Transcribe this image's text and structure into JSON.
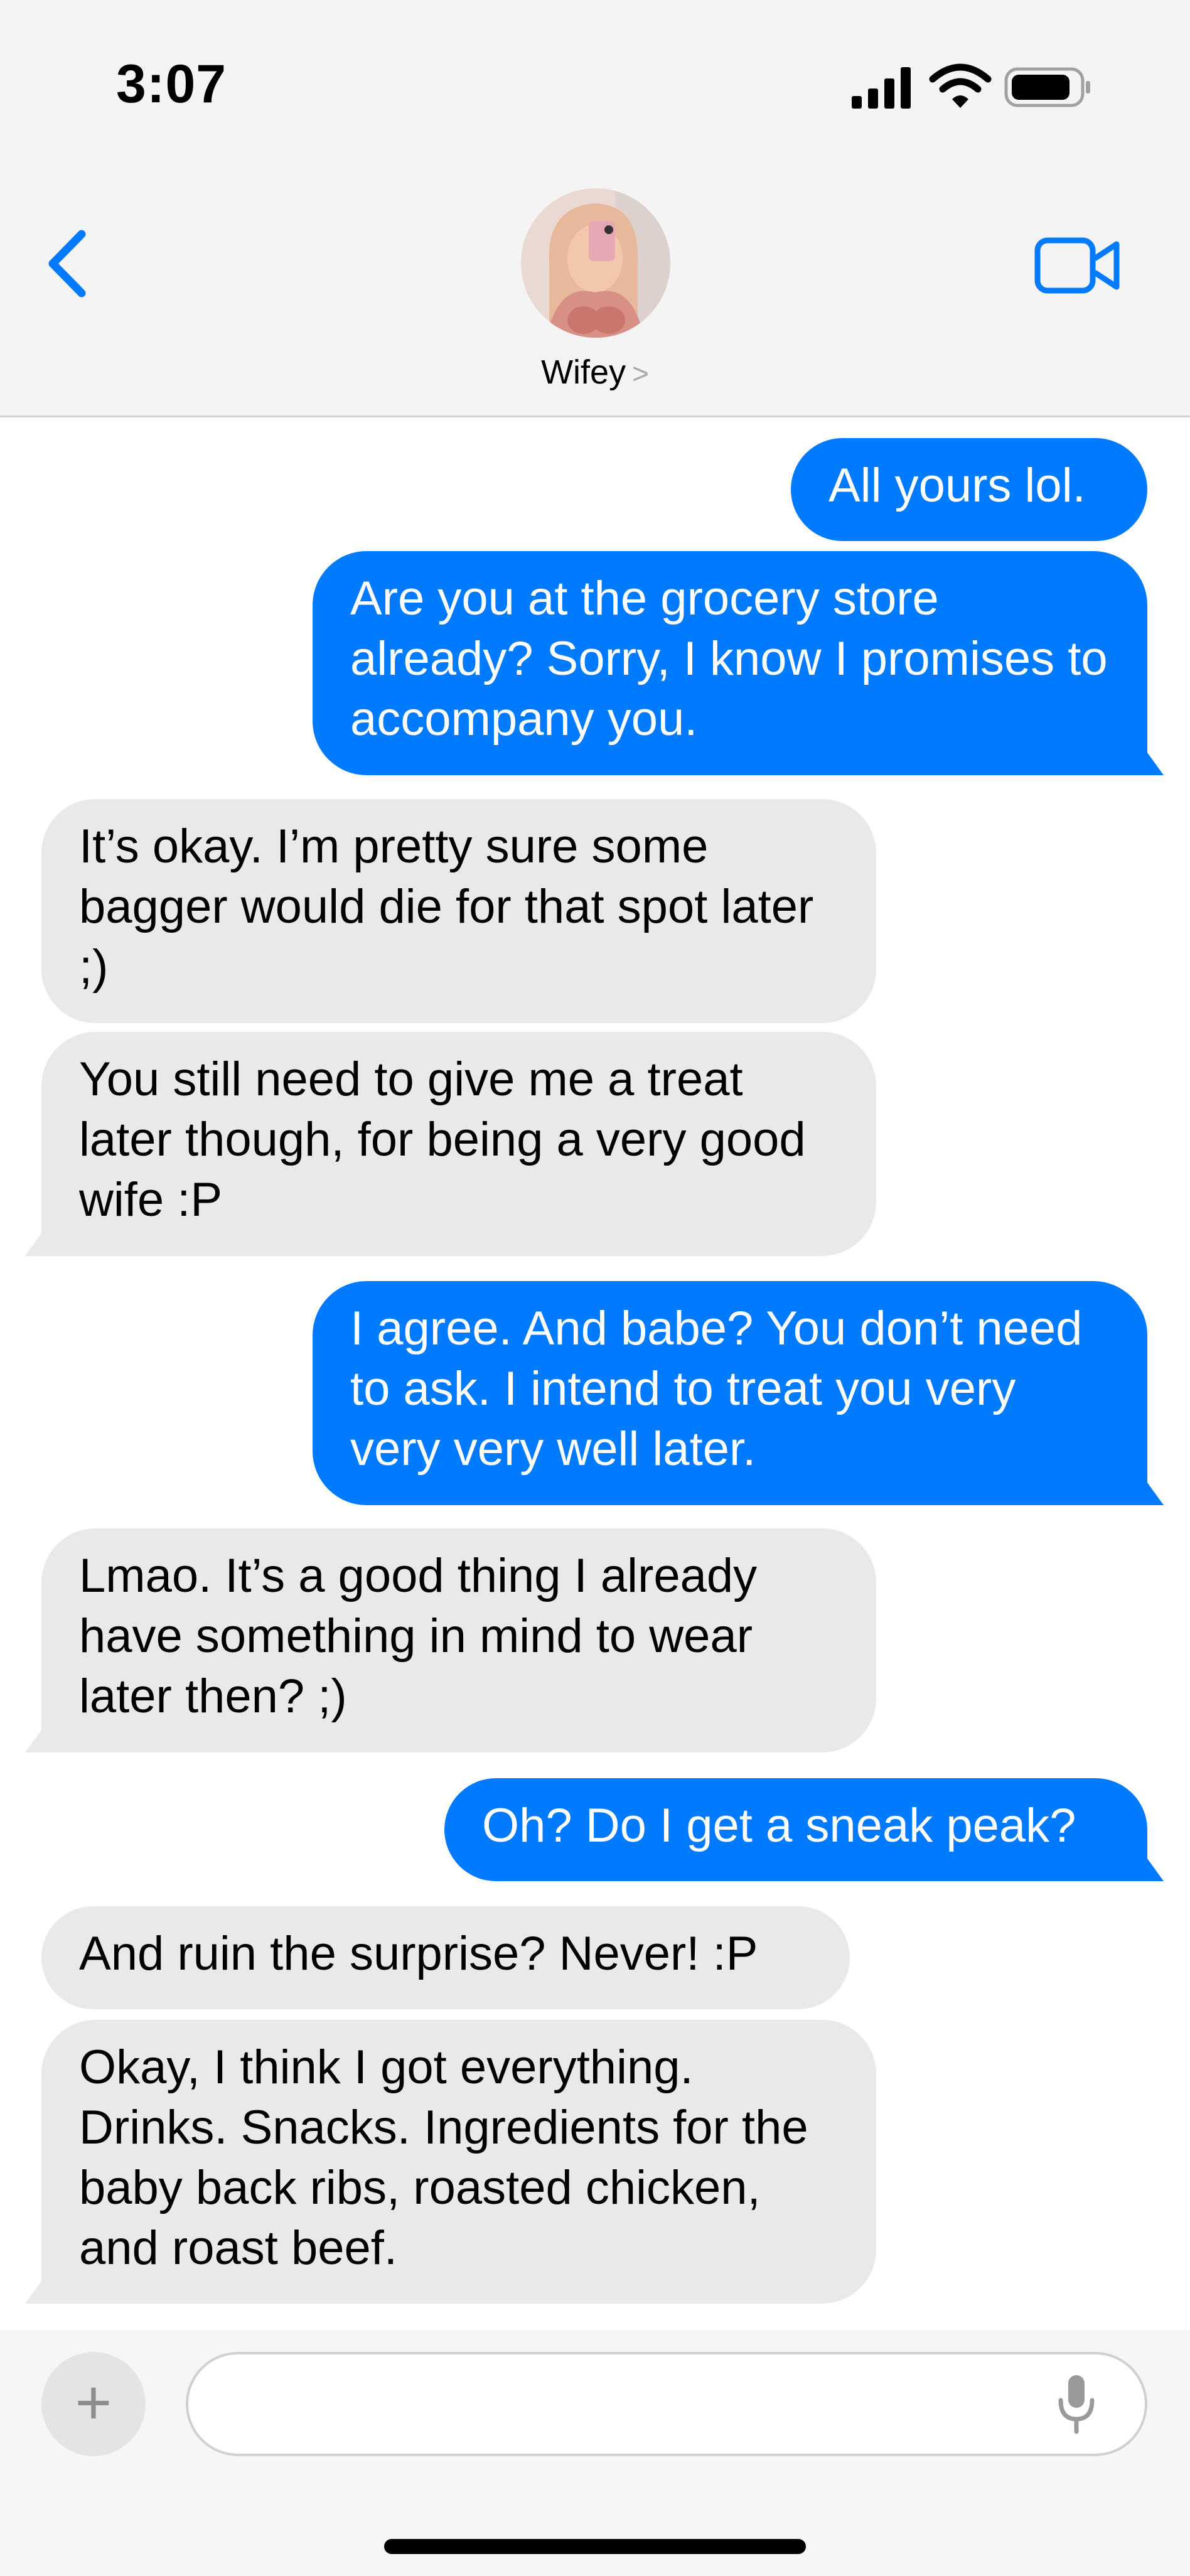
{
  "status_bar": {
    "time": "3:07",
    "icons": [
      "signal-bars-icon",
      "wifi-icon",
      "battery-icon"
    ]
  },
  "header": {
    "back_icon": "chevron-left-icon",
    "contact_name": "Wifey",
    "contact_chevron": ">",
    "video_icon": "video-camera-icon"
  },
  "messages": [
    {
      "sender": "me",
      "text": "All yours lol."
    },
    {
      "sender": "me",
      "text": "Are you at the grocery store already? Sorry, I know I promises to accompany you."
    },
    {
      "sender": "wifey",
      "text": "It’s okay. I’m pretty sure some bagger would die for that spot later ;)"
    },
    {
      "sender": "wifey",
      "text": "You still need to give me a treat later though, for being a very good wife :P"
    },
    {
      "sender": "me",
      "text": "I agree. And babe? You don’t need to ask. I intend to treat you very very very well later."
    },
    {
      "sender": "wifey",
      "text": "Lmao. It’s a good thing I already have something in mind to wear later then? ;)"
    },
    {
      "sender": "me",
      "text": "Oh? Do I get a sneak peak?"
    },
    {
      "sender": "wifey",
      "text": "And ruin the surprise? Never! :P"
    },
    {
      "sender": "wifey",
      "text": "Okay, I think I got everything. Drinks. Snacks. Ingredients for the baby back ribs, roasted chicken, and roast beef."
    }
  ],
  "input_bar": {
    "plus_label": "+",
    "placeholder": "",
    "mic_icon": "microphone-icon"
  },
  "colors": {
    "sent_bubble": "#007aff",
    "received_bubble": "#e9e9eb",
    "accent": "#007aff",
    "header_bg": "#f4f4f4"
  }
}
